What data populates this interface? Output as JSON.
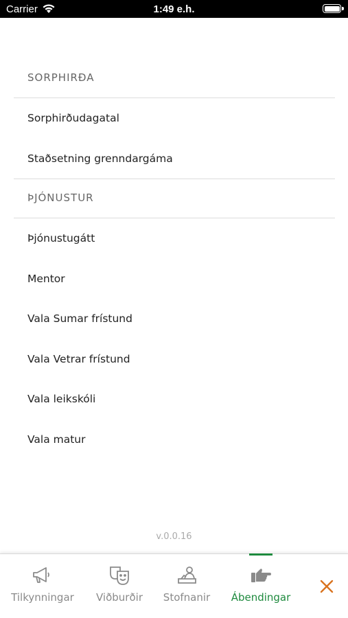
{
  "status_bar": {
    "carrier": "Carrier",
    "time": "1:49 e.h."
  },
  "sections": [
    {
      "title": "SORPHIRÐA",
      "items": [
        "Sorphirðudagatal",
        "Staðsetning grenndargáma"
      ]
    },
    {
      "title": "ÞJÓNUSTUR",
      "items": [
        "Þjónustugátt",
        "Mentor",
        "Vala Sumar frístund",
        "Vala Vetrar frístund",
        "Vala leikskóli",
        "Vala matur"
      ]
    }
  ],
  "version": "v.0.0.16",
  "tabs": [
    {
      "label": "Tilkynningar",
      "icon": "megaphone-icon",
      "active": false
    },
    {
      "label": "Viðburðir",
      "icon": "theater-masks-icon",
      "active": false
    },
    {
      "label": "Stofnanir",
      "icon": "person-desk-icon",
      "active": false
    },
    {
      "label": "Ábendingar",
      "icon": "pointing-hand-icon",
      "active": true
    }
  ],
  "close_icon": "close-icon",
  "colors": {
    "accent_green": "#1e8a3e",
    "close_orange": "#d9731f",
    "tab_gray": "#8a8a8a"
  }
}
